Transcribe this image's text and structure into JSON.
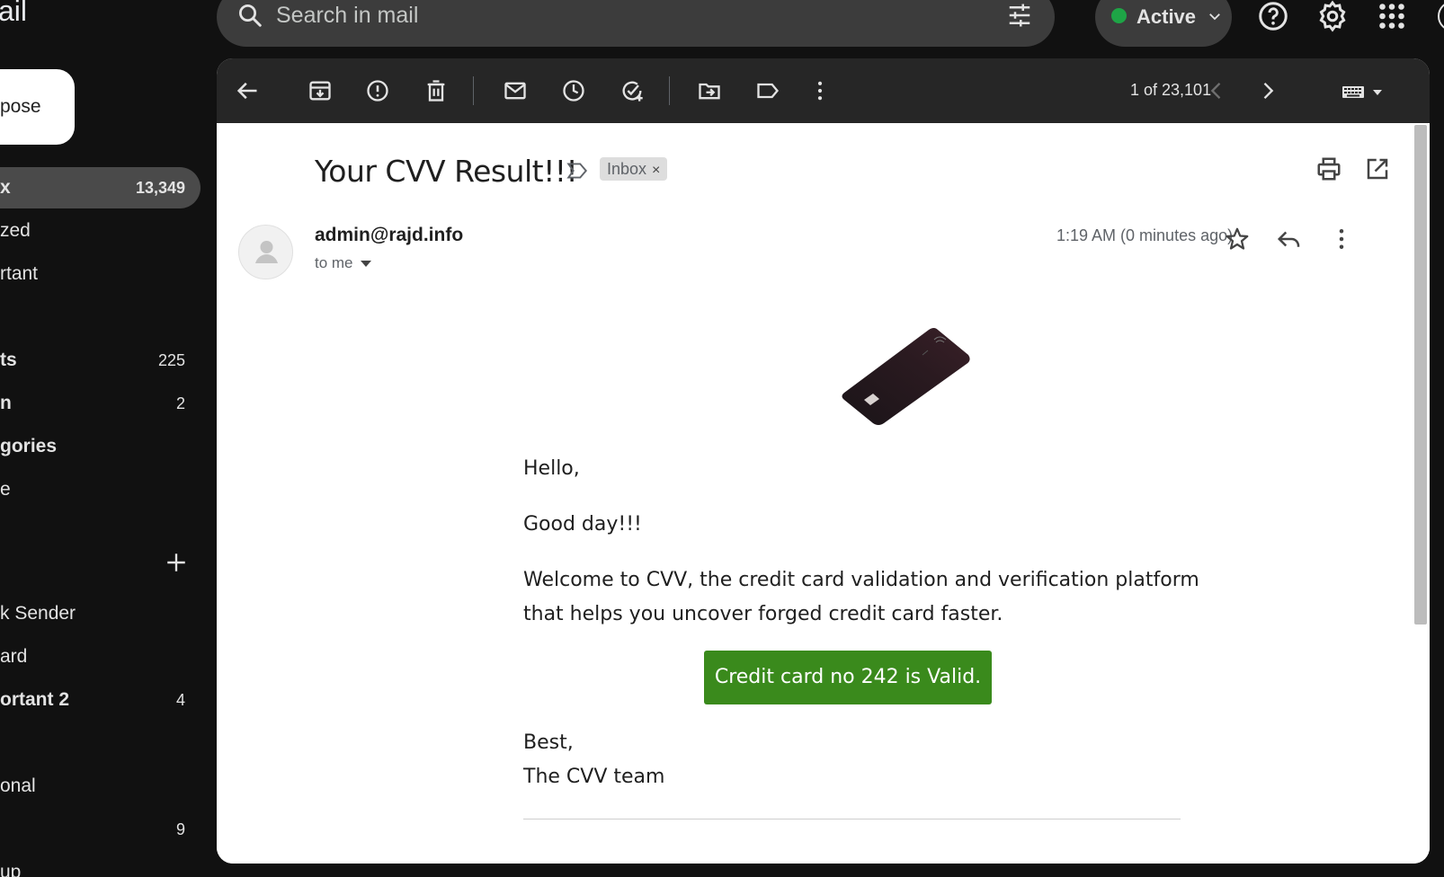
{
  "app": {
    "logo_text": "ail"
  },
  "search": {
    "placeholder": "Search in mail"
  },
  "status": {
    "label": "Active"
  },
  "sidebar": {
    "compose_label": "pose",
    "items": [
      {
        "label": "x",
        "count": "13,349"
      },
      {
        "label": "zed",
        "count": ""
      },
      {
        "label": "rtant",
        "count": ""
      },
      {
        "label": "ts",
        "count": "225"
      },
      {
        "label": "n",
        "count": "2"
      },
      {
        "label": "gories",
        "count": ""
      },
      {
        "label": "e",
        "count": ""
      },
      {
        "label": "k Sender",
        "count": ""
      },
      {
        "label": "ard",
        "count": ""
      },
      {
        "label": "ortant 2",
        "count": "4"
      },
      {
        "label": "onal",
        "count": ""
      },
      {
        "label": "",
        "count": "9"
      },
      {
        "label": "up",
        "count": ""
      }
    ]
  },
  "toolbar": {
    "pager": "1 of 23,101"
  },
  "message": {
    "subject": "Your CVV Result!!!",
    "label_chip": "Inbox",
    "label_chip_remove": "×",
    "sender": "admin@rajd.info",
    "recipient": "to me",
    "time": "1:19 AM (0 minutes ago)",
    "body": {
      "greeting": "Hello,",
      "line2": "Good day!!!",
      "para_line1": "Welcome to CVV, the credit card validation and verification platform",
      "para_line2": "that helps you uncover forged credit card faster.",
      "button": "Credit card no 242 is Valid.",
      "signoff": "Best,",
      "signature": "The CVV team"
    }
  },
  "colors": {
    "button_green": "#3a8a1c",
    "active_dot": "#1ea446",
    "sidebar_active_bg": "#4a4a4a"
  }
}
